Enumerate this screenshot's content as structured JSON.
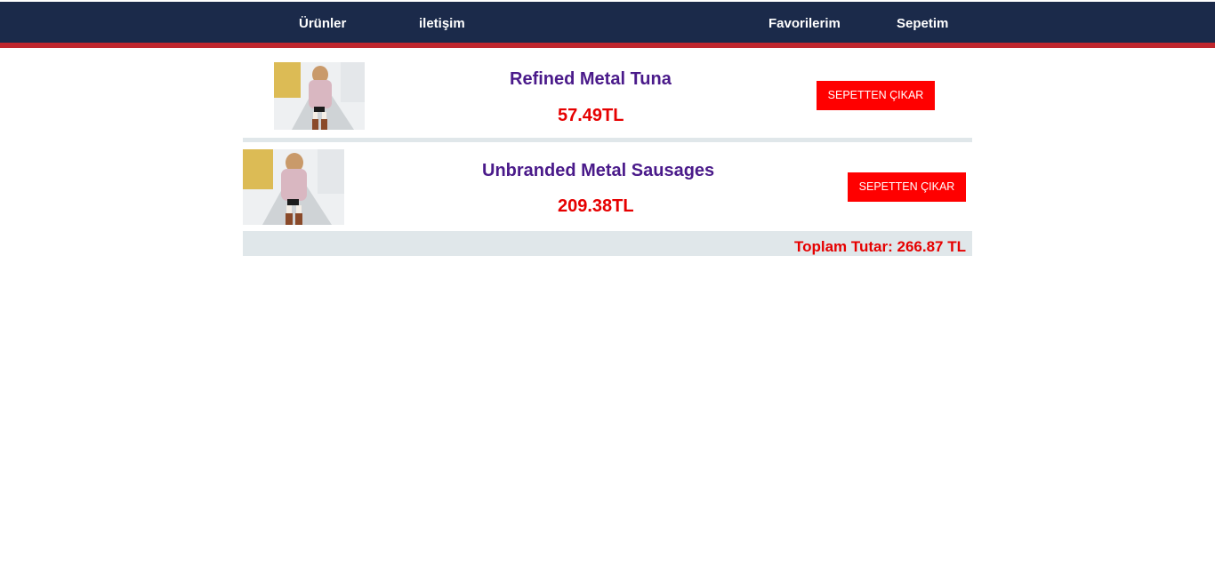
{
  "nav": {
    "products_label": "Ürünler",
    "contact_label": "iletişim",
    "favorites_label": "Favorilerim",
    "cart_label": "Sepetim"
  },
  "cart": {
    "items": [
      {
        "name": "Refined Metal Tuna",
        "price": "57.49TL",
        "remove_label": "SEPETTEN ÇIKAR",
        "image_icon": "product-photo-woman-autumn-coat"
      },
      {
        "name": "Unbranded Metal Sausages",
        "price": "209.38TL",
        "remove_label": "SEPETTEN ÇIKAR",
        "image_icon": "product-photo-woman-autumn-coat"
      }
    ],
    "total_text": "Toplam Tutar: 266.87 TL"
  },
  "colors": {
    "header_bg": "#1b2a4a",
    "header_accent": "#c0262d",
    "product_name": "#4a1a8a",
    "price": "#e60000",
    "remove_button": "#ff0000",
    "divider": "#e0e7ea"
  }
}
